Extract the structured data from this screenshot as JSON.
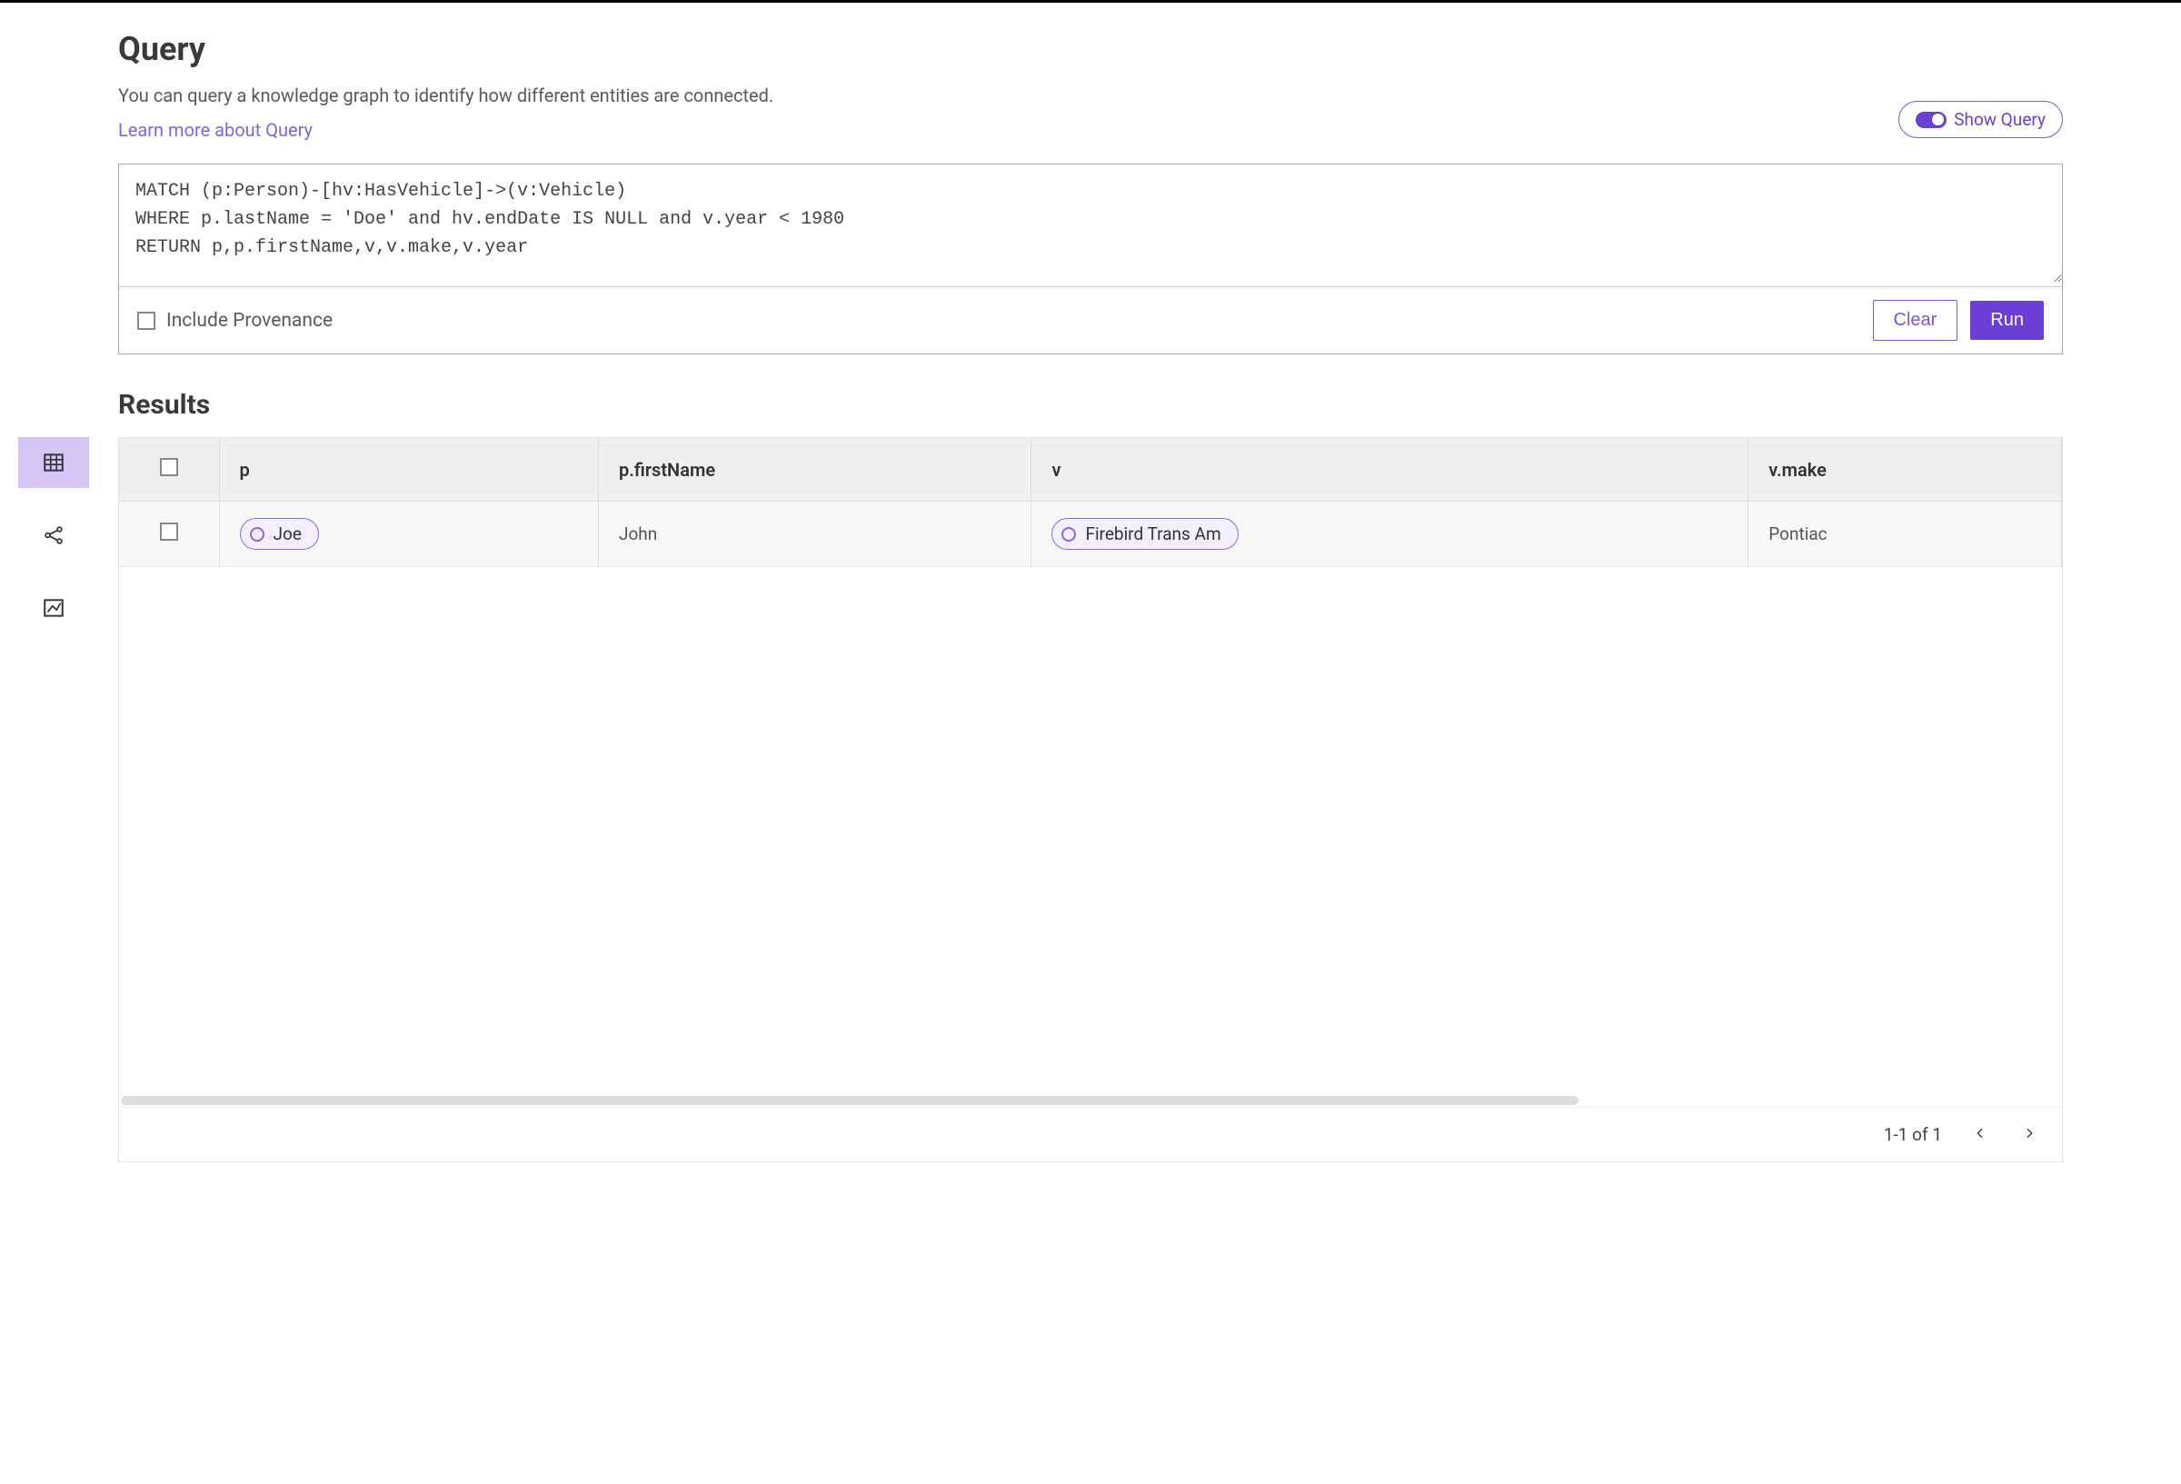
{
  "header": {
    "title": "Query",
    "subtitle": "You can query a knowledge graph to identify how different entities are connected.",
    "learn_more": "Learn more about Query",
    "show_query_label": "Show Query"
  },
  "query": {
    "text": "MATCH (p:Person)-[hv:HasVehicle]->(v:Vehicle)\nWHERE p.lastName = 'Doe' and hv.endDate IS NULL and v.year < 1980\nRETURN p,p.firstName,v,v.make,v.year",
    "include_prov_label": "Include Provenance",
    "clear_label": "Clear",
    "run_label": "Run"
  },
  "results": {
    "title": "Results",
    "columns": [
      "p",
      "p.firstName",
      "v",
      "v.make"
    ],
    "rows": [
      {
        "p": {
          "type": "entity",
          "label": "Joe"
        },
        "p_firstName": "John",
        "v": {
          "type": "entity",
          "label": "Firebird Trans Am"
        },
        "v_make": "Pontiac"
      }
    ],
    "pager": {
      "range": "1-1 of 1"
    }
  },
  "rail": {
    "items": [
      "table-view",
      "graph-view",
      "chart-view"
    ]
  }
}
